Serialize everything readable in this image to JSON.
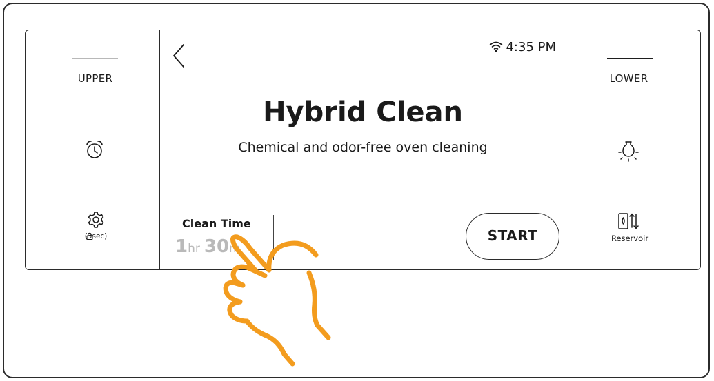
{
  "status": {
    "time": "4:35 PM",
    "wifi_icon": "wifi-icon"
  },
  "left_panel": {
    "cavity_label": "UPPER",
    "timer_icon": "alarm-clock-icon",
    "settings_icon": "gear-icon",
    "lock_label": "(3sec)",
    "lock_icon": "lock-icon"
  },
  "right_panel": {
    "cavity_label": "LOWER",
    "light_icon": "light-bulb-icon",
    "reservoir_label": "Reservoir",
    "reservoir_icon": "reservoir-icon"
  },
  "main": {
    "back_icon": "chevron-left-icon",
    "title": "Hybrid Clean",
    "subtitle": "Chemical and odor-free oven cleaning",
    "clean_time": {
      "label": "Clean Time",
      "hours": "1",
      "hours_unit": "hr",
      "minutes": "30",
      "minutes_unit": "m"
    },
    "start_label": "START"
  },
  "overlay": {
    "hand_icon": "pointing-hand-icon",
    "hand_color": "#f39c1e"
  },
  "colors": {
    "outline": "#2b2b2b",
    "muted_value": "#b9b9b9",
    "inactive_indicator": "#b8b8b8"
  }
}
